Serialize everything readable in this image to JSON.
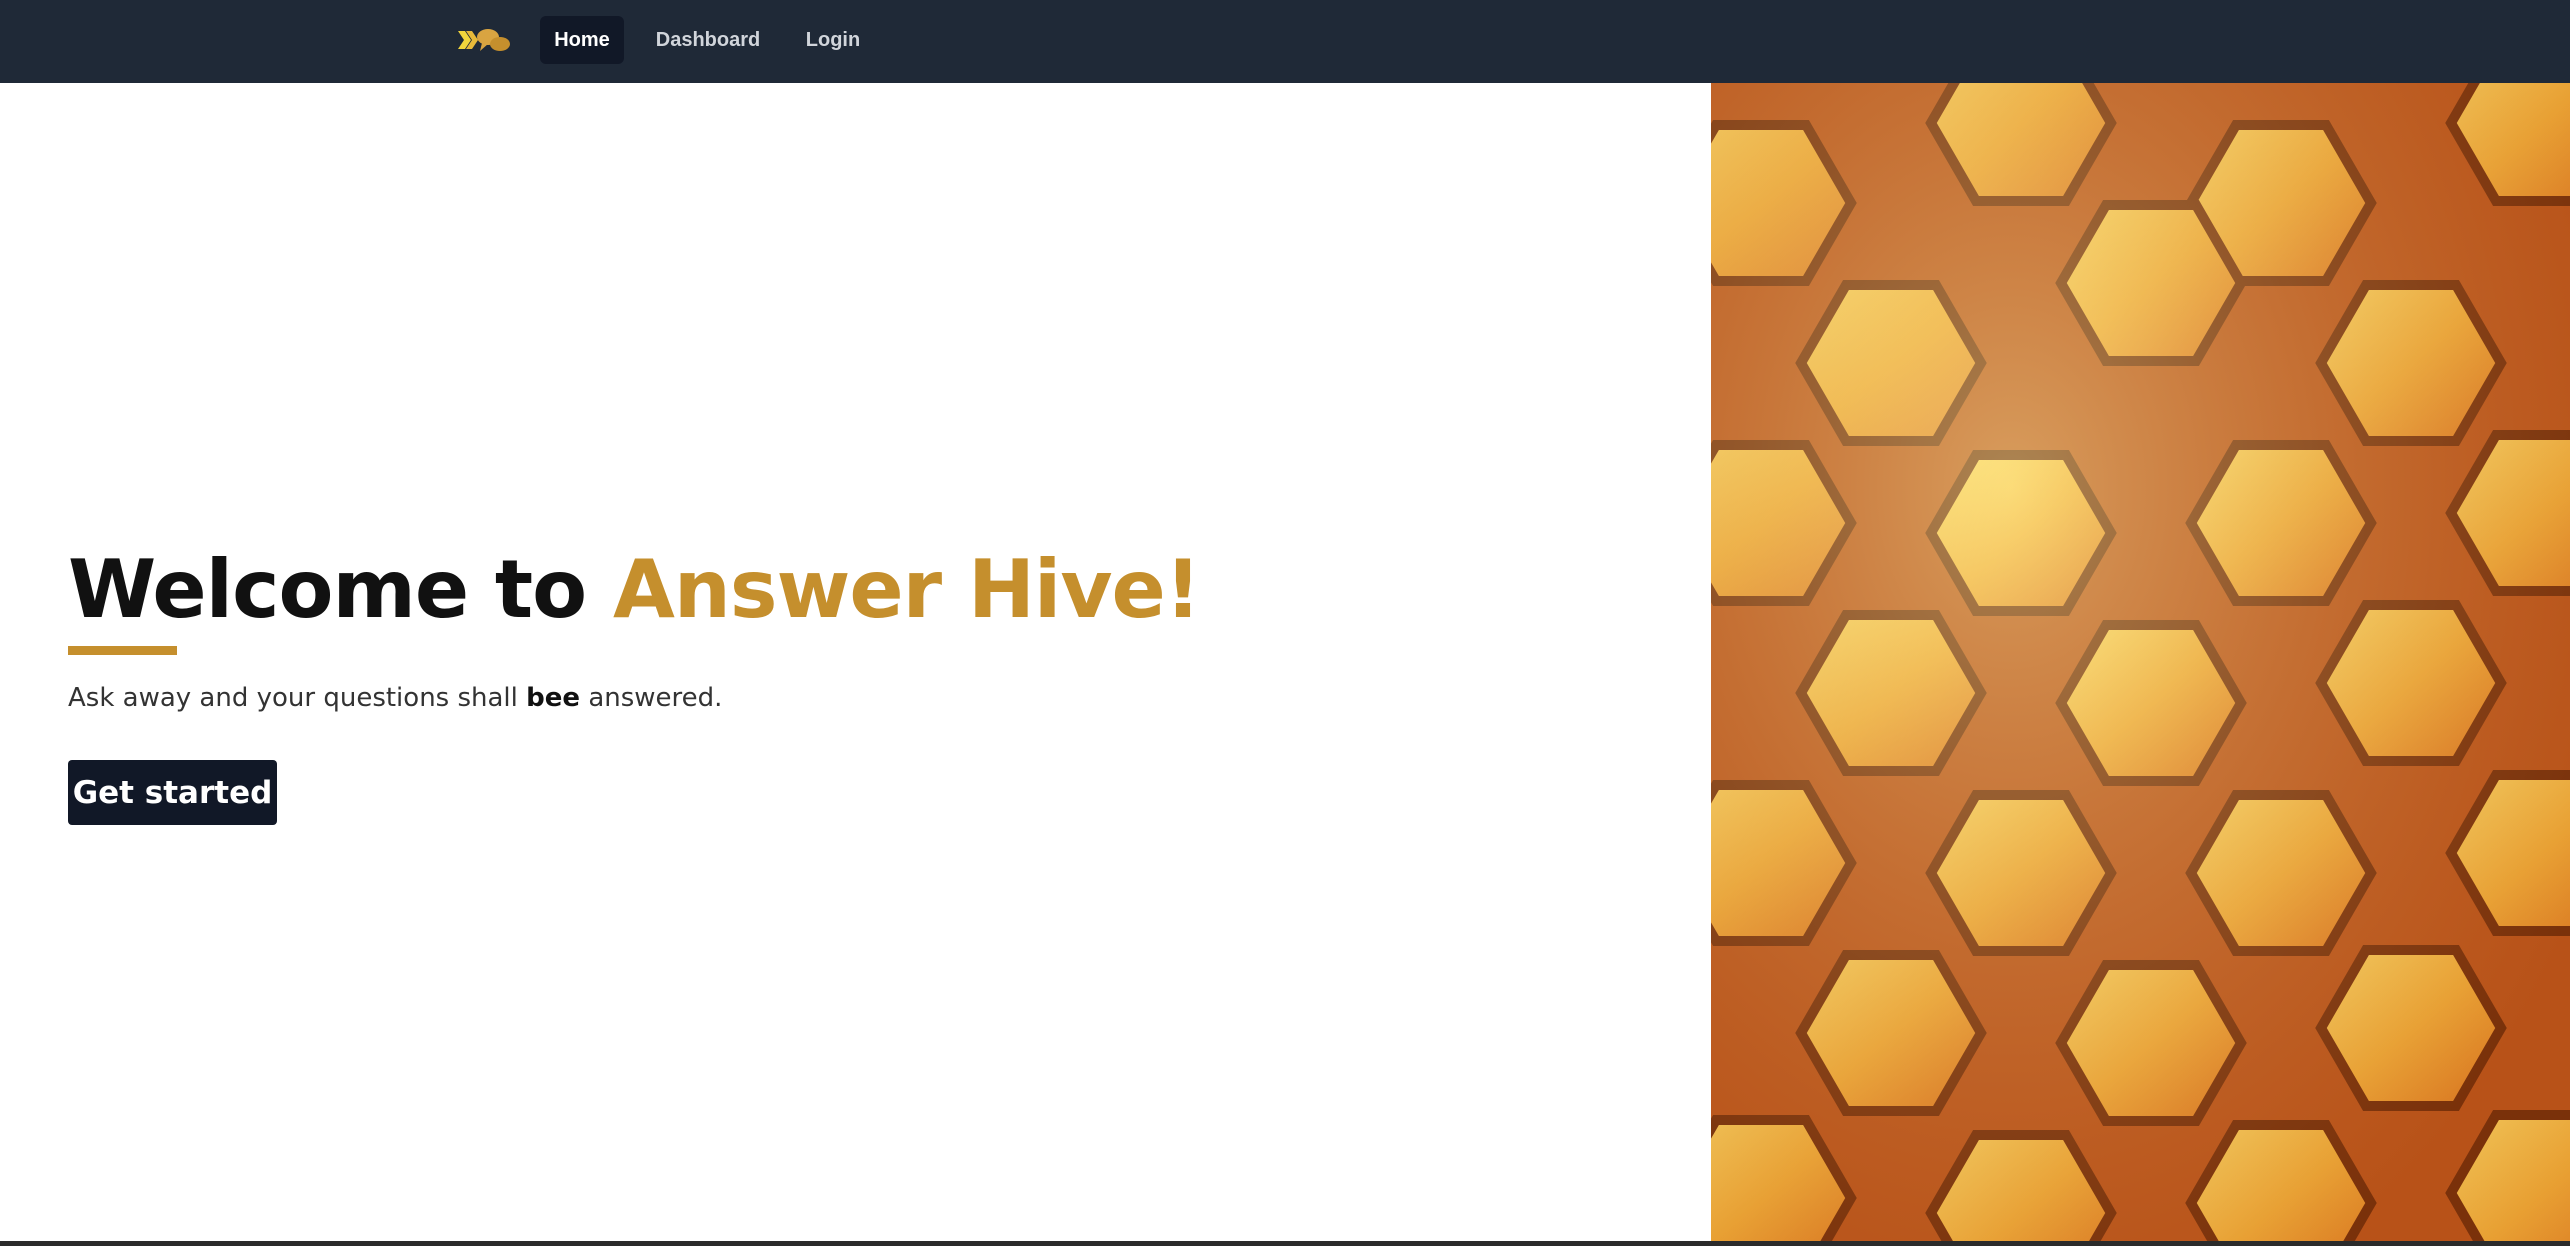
{
  "nav": {
    "logo_icon": "hive-chat-logo-icon",
    "items": [
      {
        "label": "Home",
        "active": true
      },
      {
        "label": "Dashboard",
        "active": false
      },
      {
        "label": "Login",
        "active": false
      }
    ]
  },
  "hero": {
    "title_prefix": "Welcome to",
    "title_accent": "Answer Hive!",
    "subtitle_before": "Ask away and your questions shall",
    "subtitle_bold": "bee",
    "subtitle_after": "answered.",
    "cta_label": "Get started",
    "image_icon": "honeycomb-image"
  },
  "colors": {
    "navbar": "#1f2937",
    "accent": "#c58f2d",
    "button": "#111827"
  }
}
